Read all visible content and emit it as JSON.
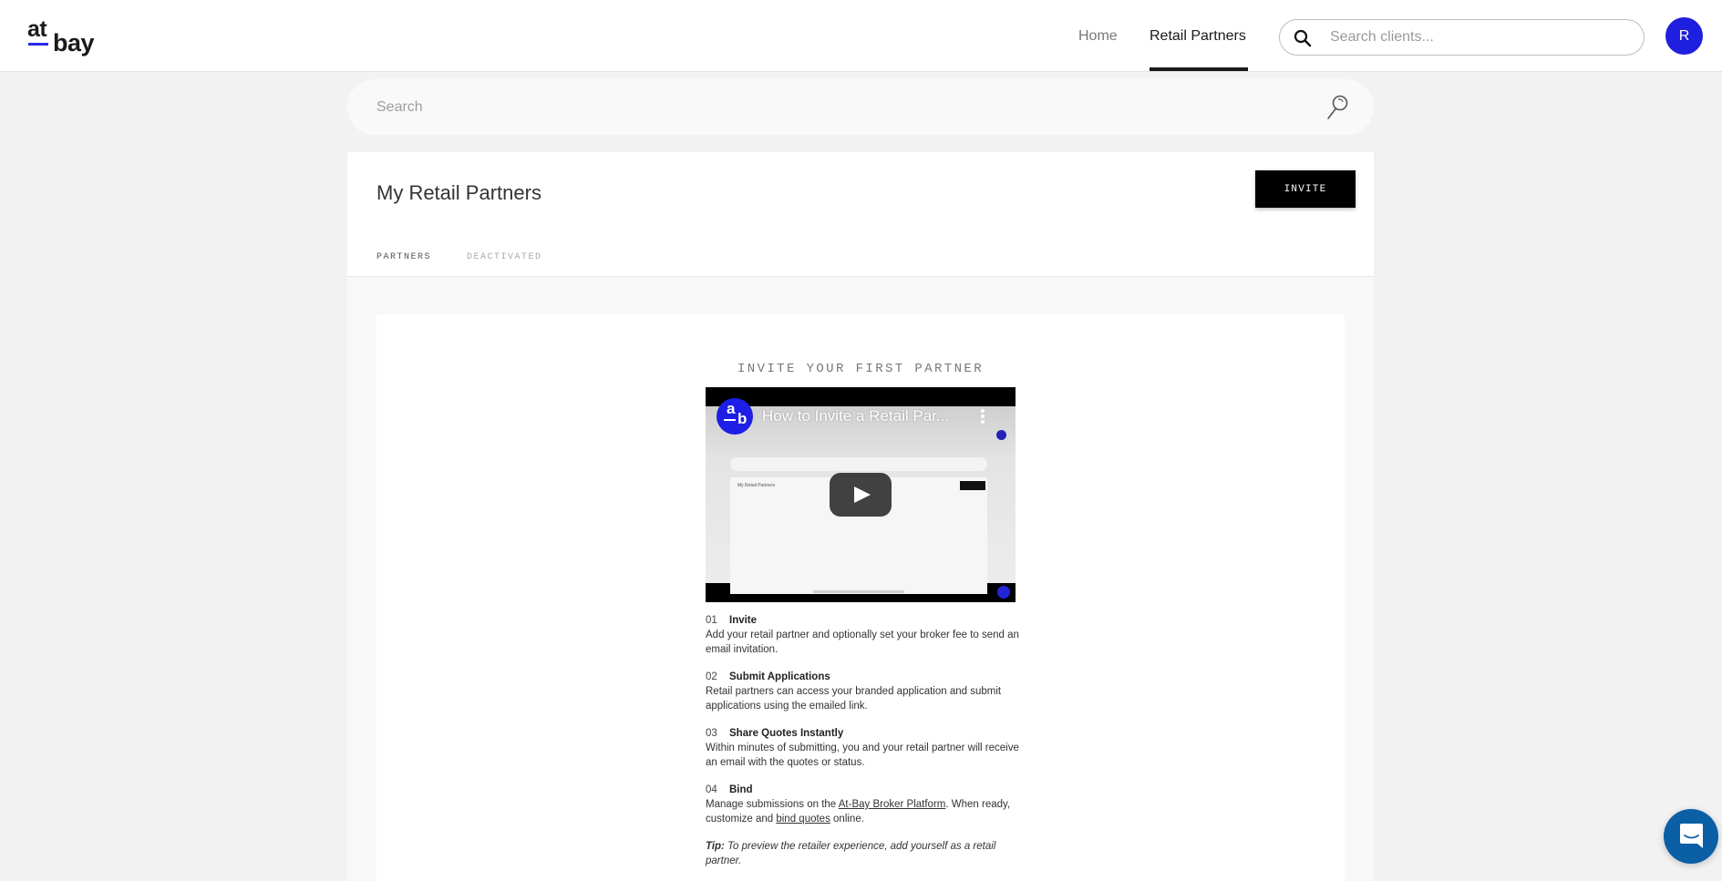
{
  "header": {
    "logo": {
      "top": "at",
      "bottom": "bay"
    },
    "nav": [
      {
        "label": "Home",
        "active": false
      },
      {
        "label": "Retail Partners",
        "active": true
      }
    ],
    "search": {
      "placeholder": "Search clients..."
    },
    "avatar_initial": "R",
    "accent_color": "#1f1fe0"
  },
  "main_search": {
    "placeholder": "Search"
  },
  "card": {
    "title": "My Retail Partners",
    "invite_button": "INVITE",
    "tabs": [
      {
        "label": "PARTNERS",
        "active": true
      },
      {
        "label": "DEACTIVATED",
        "active": false
      }
    ]
  },
  "empty_state": {
    "heading": "INVITE YOUR FIRST PARTNER",
    "video": {
      "title": "How to Invite a Retail Par...",
      "channel_logo": {
        "top": "a",
        "bottom": "b"
      },
      "preview_title": "My Retail Partners"
    },
    "steps": [
      {
        "number": "01",
        "title": "Invite",
        "body": "Add your retail partner and optionally set your broker fee to send an email invitation."
      },
      {
        "number": "02",
        "title": "Submit Applications",
        "body": "Retail partners can access your branded application and submit applications using the emailed link."
      },
      {
        "number": "03",
        "title": "Share Quotes Instantly",
        "body": "Within minutes of submitting, you and your retail partner will receive an email with the quotes or status."
      },
      {
        "number": "04",
        "title": "Bind",
        "body_prefix": "Manage submissions on the ",
        "link1": "At-Bay Broker Platform",
        "body_middle": ". When ready, customize and ",
        "link2": "bind quotes",
        "body_suffix": " online."
      }
    ],
    "tip": {
      "label": "Tip:",
      "text": " To preview the retailer experience, add yourself as a retail partner."
    }
  },
  "chat_launcher": {
    "color": "#0b5fa5"
  }
}
